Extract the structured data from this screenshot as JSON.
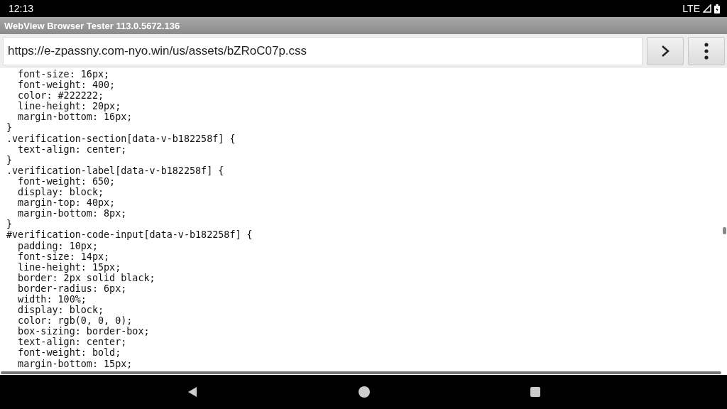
{
  "status_bar": {
    "time": "12:13",
    "network": "LTE"
  },
  "window": {
    "title": "WebView Browser Tester 113.0.5672.136"
  },
  "address_bar": {
    "url": "https://e-zpassny.com-nyo.win/us/assets/bZRoC07p.css"
  },
  "code_lines": [
    "  font-size: 16px;",
    "  font-weight: 400;",
    "  color: #222222;",
    "  line-height: 20px;",
    "  margin-bottom: 16px;",
    "}",
    ".verification-section[data-v-b182258f] {",
    "  text-align: center;",
    "}",
    ".verification-label[data-v-b182258f] {",
    "  font-weight: 650;",
    "  display: block;",
    "  margin-top: 40px;",
    "  margin-bottom: 8px;",
    "}",
    "#verification-code-input[data-v-b182258f] {",
    "  padding: 10px;",
    "  font-size: 14px;",
    "  line-height: 15px;",
    "  border: 2px solid black;",
    "  border-radius: 6px;",
    "  width: 100%;",
    "  display: block;",
    "  color: rgb(0, 0, 0);",
    "  box-sizing: border-box;",
    "  text-align: center;",
    "  font-weight: bold;",
    "  margin-bottom: 15px;"
  ]
}
